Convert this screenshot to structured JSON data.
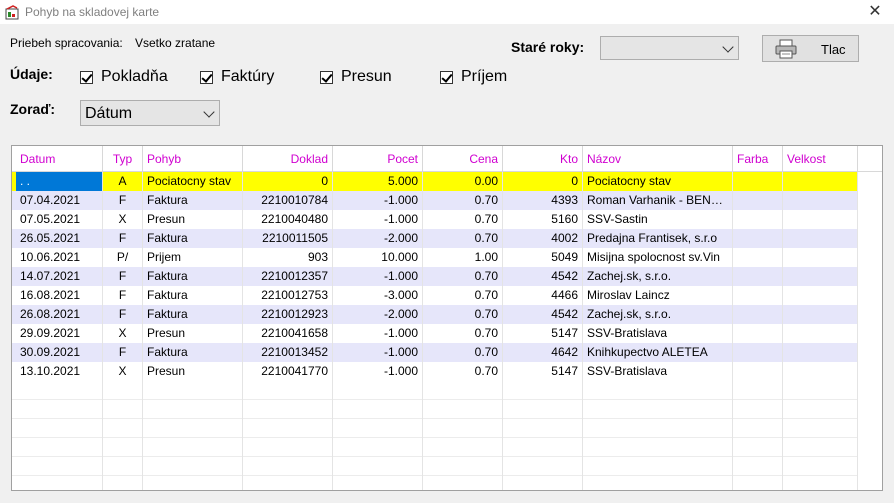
{
  "window": {
    "title": "Pohyb na skladovej karte"
  },
  "status": {
    "label": "Priebeh spracovania:",
    "value": "Vsetko zratane"
  },
  "old_years": {
    "label": "Staré roky:",
    "value": ""
  },
  "print_button": {
    "label": "Tlac"
  },
  "data_section": {
    "label": "Údaje:",
    "checkboxes": [
      {
        "label": "Pokladňa",
        "checked": true
      },
      {
        "label": "Faktúry",
        "checked": true
      },
      {
        "label": "Presun",
        "checked": true
      },
      {
        "label": "Príjem",
        "checked": true
      }
    ]
  },
  "sort": {
    "label": "Zoraď:",
    "value": "Dátum"
  },
  "table": {
    "headers": [
      "Datum",
      "Typ",
      "Pohyb",
      "Doklad",
      "Pocet",
      "Cena",
      "Kto",
      "Názov",
      "Farba",
      "Velkost"
    ],
    "rows": [
      [
        ". .",
        "A",
        "Pociatocny stav",
        "0",
        "5.000",
        "0.00",
        "0",
        "Pociatocny stav",
        "",
        ""
      ],
      [
        "07.04.2021",
        "F",
        "Faktura",
        "2210010784",
        "-1.000",
        "0.70",
        "4393",
        "Roman Varhanik - BEN…",
        "",
        ""
      ],
      [
        "07.05.2021",
        "X",
        "Presun",
        "2210040480",
        "-1.000",
        "0.70",
        "5160",
        "SSV-Sastin",
        "",
        ""
      ],
      [
        "26.05.2021",
        "F",
        "Faktura",
        "2210011505",
        "-2.000",
        "0.70",
        "4002",
        "Predajna Frantisek, s.r.o",
        "",
        ""
      ],
      [
        "10.06.2021",
        "P/",
        "Prijem",
        "903",
        "10.000",
        "1.00",
        "5049",
        "Misijna spolocnost sv.Vin",
        "",
        ""
      ],
      [
        "14.07.2021",
        "F",
        "Faktura",
        "2210012357",
        "-1.000",
        "0.70",
        "4542",
        "Zachej.sk, s.r.o.",
        "",
        ""
      ],
      [
        "16.08.2021",
        "F",
        "Faktura",
        "2210012753",
        "-3.000",
        "0.70",
        "4466",
        "Miroslav Laincz",
        "",
        ""
      ],
      [
        "26.08.2021",
        "F",
        "Faktura",
        "2210012923",
        "-2.000",
        "0.70",
        "4542",
        "Zachej.sk, s.r.o.",
        "",
        ""
      ],
      [
        "29.09.2021",
        "X",
        "Presun",
        "2210041658",
        "-1.000",
        "0.70",
        "5147",
        "SSV-Bratislava",
        "",
        ""
      ],
      [
        "30.09.2021",
        "F",
        "Faktura",
        "2210013452",
        "-1.000",
        "0.70",
        "4642",
        "Knihkupectvo ALETEA",
        "",
        ""
      ],
      [
        "13.10.2021",
        "X",
        "Presun",
        "2210041770",
        "-1.000",
        "0.70",
        "5147",
        "SSV-Bratislava",
        "",
        ""
      ]
    ]
  },
  "colors": {
    "header_text": "#d000d0",
    "selected_row": "#ffff00",
    "alt_row": "#e6e6fa",
    "focus_cell": "#0078d7"
  }
}
